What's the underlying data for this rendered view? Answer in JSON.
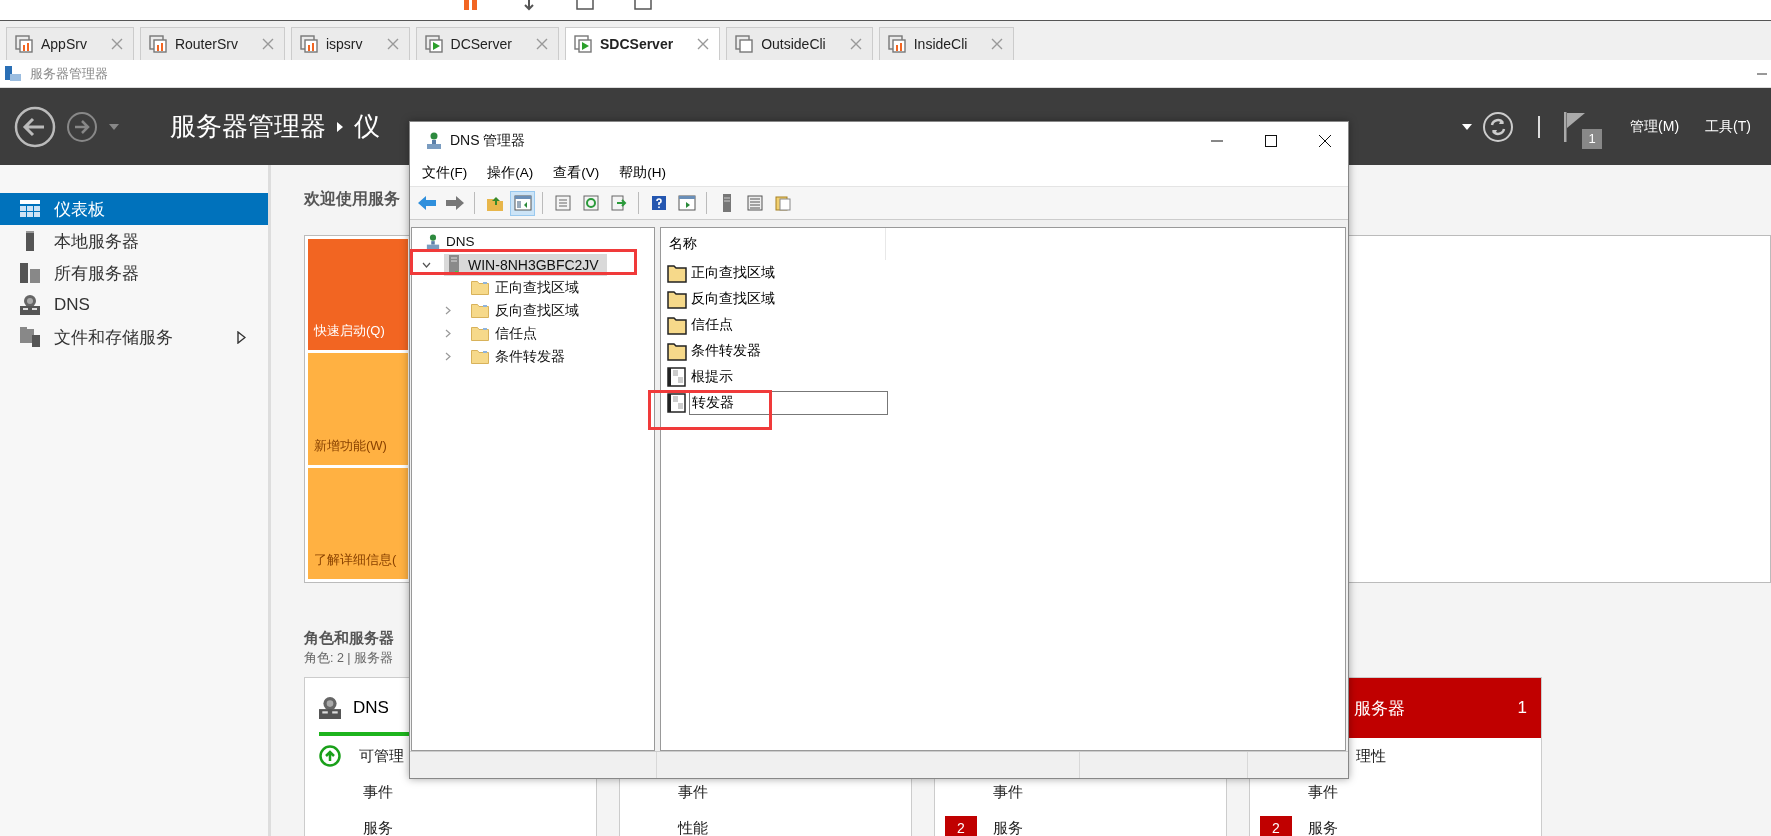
{
  "tabs": [
    {
      "label": "AppSrv",
      "kind": "stats",
      "selected": false
    },
    {
      "label": "RouterSrv",
      "kind": "stats",
      "selected": false
    },
    {
      "label": "ispsrv",
      "kind": "stats",
      "selected": false
    },
    {
      "label": "DCServer",
      "kind": "running",
      "selected": false
    },
    {
      "label": "SDCServer",
      "kind": "running",
      "selected": true
    },
    {
      "label": "OutsideCli",
      "kind": "off",
      "selected": false
    },
    {
      "label": "InsideCli",
      "kind": "stats",
      "selected": false
    }
  ],
  "app_title": "服务器管理器",
  "header": {
    "title": "服务器管理器",
    "page": "仪",
    "flag_count": "1",
    "menus": [
      "管理(M)",
      "工具(T)"
    ]
  },
  "sidebar": {
    "items": [
      {
        "label": "仪表板",
        "selected": true,
        "has_submenu": false
      },
      {
        "label": "本地服务器",
        "selected": false,
        "has_submenu": false
      },
      {
        "label": "所有服务器",
        "selected": false,
        "has_submenu": false
      },
      {
        "label": "DNS",
        "selected": false,
        "has_submenu": false
      },
      {
        "label": "文件和存储服务",
        "selected": false,
        "has_submenu": true
      }
    ]
  },
  "welcome": {
    "title": "欢迎使用服务",
    "tiles": [
      {
        "label": "快速启动(Q)",
        "kind": "primary"
      },
      {
        "label": "新增功能(W)",
        "kind": "secondary"
      },
      {
        "label": "了解详细信息(",
        "kind": "secondary"
      }
    ]
  },
  "roles": {
    "title": "角色和服务器",
    "summary": "角色: 2 | 服务器",
    "cards": [
      {
        "title": "DNS",
        "kind": "ok",
        "status": "可管理",
        "status_icon": true,
        "rows": [
          {
            "label": "事件"
          },
          {
            "label": "服务"
          }
        ]
      },
      {
        "rows": [
          {
            "label": "事件"
          },
          {
            "label": "性能"
          }
        ]
      },
      {
        "rows": [
          {
            "label": "事件"
          },
          {
            "label": "服务",
            "badge": "2"
          }
        ]
      },
      {
        "title": "服务器",
        "count": "1",
        "kind": "alert",
        "status": "理性",
        "rows": [
          {
            "label": "事件"
          },
          {
            "label": "服务",
            "badge": "2"
          }
        ]
      }
    ]
  },
  "dns_window": {
    "title": "DNS 管理器",
    "menu": [
      "文件(F)",
      "操作(A)",
      "查看(V)",
      "帮助(H)"
    ],
    "toolbar": [
      {
        "kind": "back",
        "pressed": false
      },
      {
        "kind": "forward",
        "pressed": false
      },
      {
        "kind": "separator"
      },
      {
        "kind": "up",
        "pressed": false
      },
      {
        "kind": "tree",
        "pressed": true
      },
      {
        "kind": "separator"
      },
      {
        "kind": "properties",
        "pressed": false
      },
      {
        "kind": "refresh",
        "pressed": false
      },
      {
        "kind": "export",
        "pressed": false
      },
      {
        "kind": "separator"
      },
      {
        "kind": "help",
        "pressed": false
      },
      {
        "kind": "console",
        "pressed": false
      },
      {
        "kind": "separator"
      },
      {
        "kind": "server",
        "pressed": false
      },
      {
        "kind": "list",
        "pressed": false
      },
      {
        "kind": "notes",
        "pressed": false
      }
    ],
    "tree": {
      "label": "DNS",
      "children": [
        {
          "label": "WIN-8NH3GBFC2JV",
          "expanded": true,
          "selected": true,
          "annotated": true,
          "children": [
            {
              "label": "正向查找区域",
              "expandable": false
            },
            {
              "label": "反向查找区域",
              "expandable": true
            },
            {
              "label": "信任点",
              "expandable": true
            },
            {
              "label": "条件转发器",
              "expandable": true
            }
          ]
        }
      ]
    },
    "list": {
      "columns": [
        "名称"
      ],
      "items": [
        {
          "label": "正向查找区域",
          "kind": "folder",
          "editing": false,
          "annotated": false
        },
        {
          "label": "反向查找区域",
          "kind": "folder",
          "editing": false,
          "annotated": false
        },
        {
          "label": "信任点",
          "kind": "folder",
          "editing": false,
          "annotated": false
        },
        {
          "label": "条件转发器",
          "kind": "folder",
          "editing": false,
          "annotated": false
        },
        {
          "label": "根提示",
          "kind": "record",
          "editing": false,
          "annotated": false
        },
        {
          "label": "转发器",
          "kind": "record",
          "editing": true,
          "annotated": true
        }
      ]
    }
  }
}
